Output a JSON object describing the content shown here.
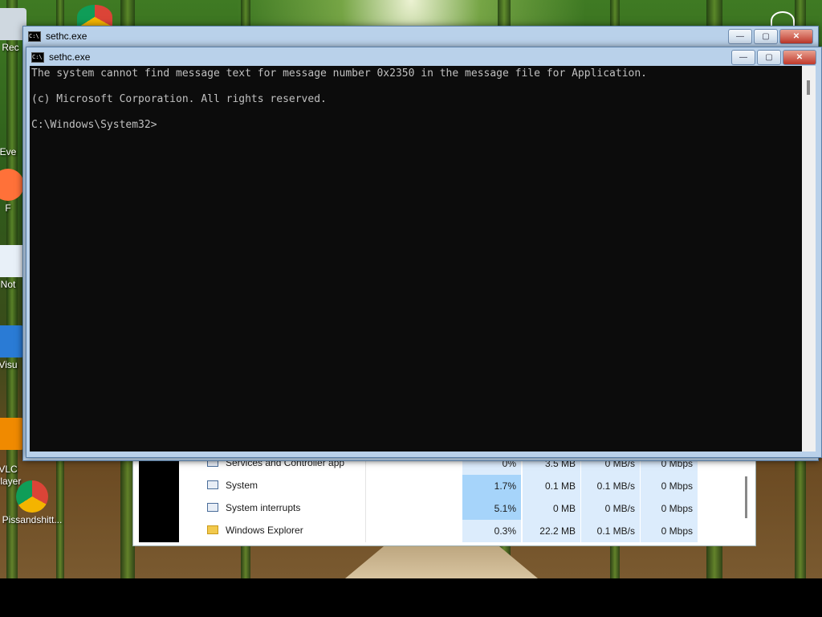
{
  "desktop": {
    "icons": [
      {
        "label": "Rec",
        "icon": "recycle-bin-icon"
      },
      {
        "label": "Eve",
        "icon": "shortcut-icon"
      },
      {
        "label": "F",
        "icon": "firefox-icon"
      },
      {
        "label": "Not",
        "icon": "notepad-icon"
      },
      {
        "label": "Visu",
        "icon": "visual-studio-icon"
      },
      {
        "label": "VLC\nplayer",
        "icon": "vlc-icon"
      },
      {
        "label": "Pissandshitt...",
        "icon": "chrome-icon"
      }
    ]
  },
  "back_window": {
    "title": "sethc.exe",
    "buttons": {
      "minimize": "—",
      "maximize": "▢",
      "close": "✕"
    }
  },
  "front_window": {
    "title": "sethc.exe",
    "buttons": {
      "minimize": "—",
      "maximize": "▢",
      "close": "✕"
    },
    "console_lines": [
      "The system cannot find message text for message number 0x2350 in the message file for Application.",
      "",
      "(c) Microsoft Corporation. All rights reserved.",
      "",
      "C:\\Windows\\System32>"
    ]
  },
  "task_manager": {
    "rows": [
      {
        "name": "Services and Controller app",
        "icon": "service-icon",
        "cpu": "0%",
        "memory": "3.5 MB",
        "disk": "0 MB/s",
        "network": "0 Mbps",
        "cpu_hot": false
      },
      {
        "name": "System",
        "icon": "service-icon",
        "cpu": "1.7%",
        "memory": "0.1 MB",
        "disk": "0.1 MB/s",
        "network": "0 Mbps",
        "cpu_hot": true
      },
      {
        "name": "System interrupts",
        "icon": "service-icon",
        "cpu": "5.1%",
        "memory": "0 MB",
        "disk": "0 MB/s",
        "network": "0 Mbps",
        "cpu_hot": true
      },
      {
        "name": "Windows Explorer",
        "icon": "folder-icon",
        "cpu": "0.3%",
        "memory": "22.2 MB",
        "disk": "0.1 MB/s",
        "network": "0 Mbps",
        "cpu_hot": false
      }
    ]
  },
  "colors": {
    "console_bg": "#0c0c0c",
    "console_text": "#c0c0c0",
    "window_frame": "#b9d1ea",
    "cpu_highlight": "#a6d4fa",
    "cell_bg": "#dcecfc"
  }
}
